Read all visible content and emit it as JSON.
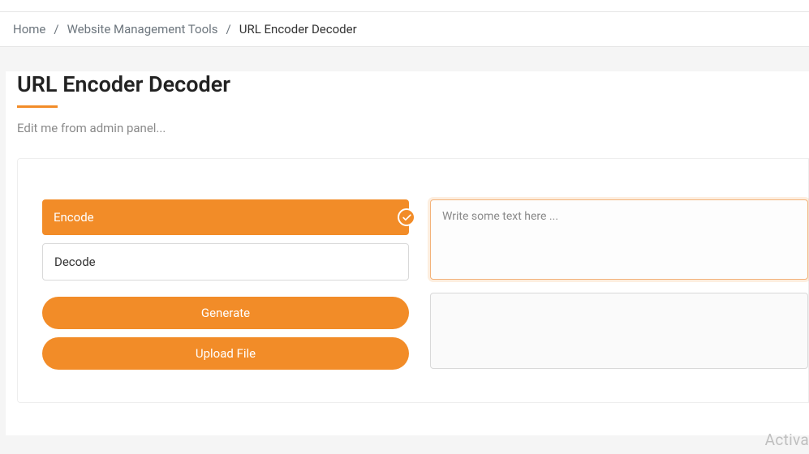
{
  "breadcrumb": {
    "items": [
      "Home",
      "Website Management Tools"
    ],
    "current": "URL Encoder Decoder"
  },
  "page": {
    "title": "URL Encoder Decoder",
    "subtitle": "Edit me from admin panel..."
  },
  "options": {
    "encode_label": "Encode",
    "decode_label": "Decode"
  },
  "buttons": {
    "generate": "Generate",
    "upload": "Upload File"
  },
  "input": {
    "placeholder": "Write some text here ..."
  },
  "watermark": "Activa"
}
